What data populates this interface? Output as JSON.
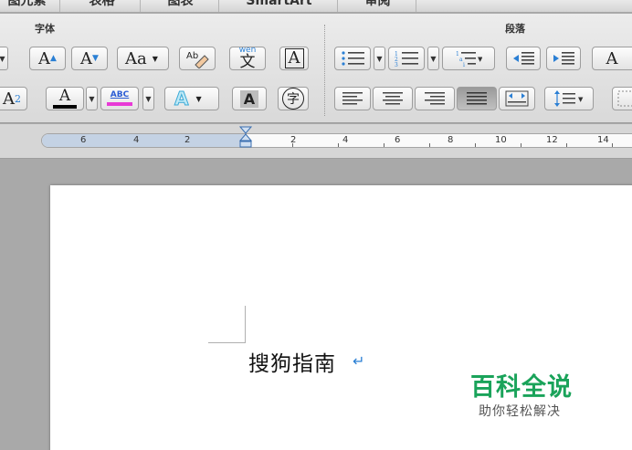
{
  "tabs": [
    "图元素",
    "表格",
    "图表",
    "SmartArt",
    "审阅"
  ],
  "ribbon": {
    "font_group_label": "字体",
    "paragraph_group_label": "段落",
    "grow_font": "A",
    "shrink_font": "A",
    "change_case": "Aa",
    "phonetic_guide_top": "wen",
    "phonetic_guide": "文",
    "char_border": "A",
    "subscript": "A",
    "subscript_sub": "2",
    "font_color": "A",
    "highlight": "ABC",
    "text_effects": "A",
    "char_shading": "A",
    "enclose_chars": "字",
    "font_size_text_effects": "A"
  },
  "ruler": {
    "labels": [
      "6",
      "4",
      "2",
      "2",
      "4",
      "6",
      "8",
      "10",
      "12",
      "14"
    ]
  },
  "document": {
    "text": "搜狗指南",
    "return_mark": "↵"
  },
  "watermark": {
    "title": "百科全说",
    "subtitle": "助你轻松解决"
  },
  "colors": {
    "font_color_bar": "#000000",
    "highlight_bar": "#e83ad6",
    "accent_blue": "#2a7fd4",
    "watermark_green": "#1aa35a"
  }
}
